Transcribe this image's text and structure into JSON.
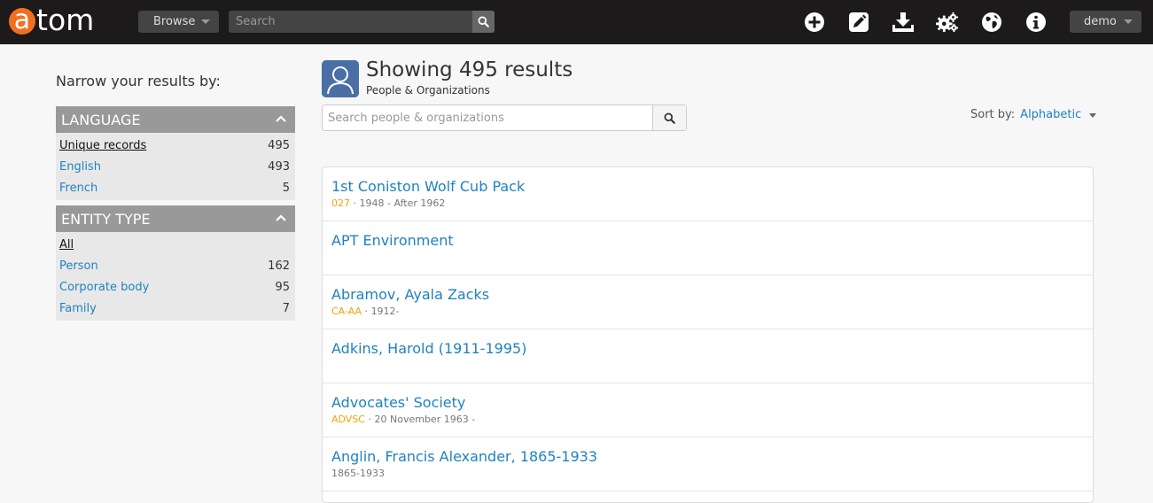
{
  "app": {
    "logo_letter": "a",
    "logo_rest": "tom",
    "browse_label": "Browse",
    "search_placeholder": "Search",
    "user_label": "demo",
    "accent_color": "#f26f21",
    "link_color": "#1f82c0"
  },
  "top_icons": [
    "add-icon",
    "edit-icon",
    "import-icon",
    "settings-icon",
    "language-icon",
    "info-icon"
  ],
  "sidebar": {
    "title": "Narrow your results by:",
    "facets": [
      {
        "heading": "LANGUAGE",
        "items": [
          {
            "label": "Unique records",
            "count": "495",
            "active": true
          },
          {
            "label": "English",
            "count": "493"
          },
          {
            "label": "French",
            "count": "5"
          }
        ]
      },
      {
        "heading": "ENTITY TYPE",
        "items": [
          {
            "label": "All",
            "count": "",
            "active": true
          },
          {
            "label": "Person",
            "count": "162"
          },
          {
            "label": "Corporate body",
            "count": "95"
          },
          {
            "label": "Family",
            "count": "7"
          }
        ]
      }
    ]
  },
  "main": {
    "title": "Showing 495 results",
    "subtitle": "People & Organizations",
    "search_placeholder": "Search people & organizations",
    "sort_label": "Sort by:",
    "sort_value": "Alphabetic",
    "results": [
      {
        "title": "1st Coniston Wolf Cub Pack",
        "code": "027",
        "dates": "1948 - After 1962"
      },
      {
        "title": "APT Environment",
        "code": "",
        "dates": ""
      },
      {
        "title": "Abramov, Ayala Zacks",
        "code": "CA-AA",
        "dates": "1912-"
      },
      {
        "title": "Adkins, Harold (1911-1995)",
        "code": "",
        "dates": ""
      },
      {
        "title": "Advocates' Society",
        "code": "ADVSC",
        "dates": "20 November 1963 -"
      },
      {
        "title": "Anglin, Francis Alexander, 1865-1933",
        "code": "",
        "dates": "1865-1933"
      }
    ]
  }
}
